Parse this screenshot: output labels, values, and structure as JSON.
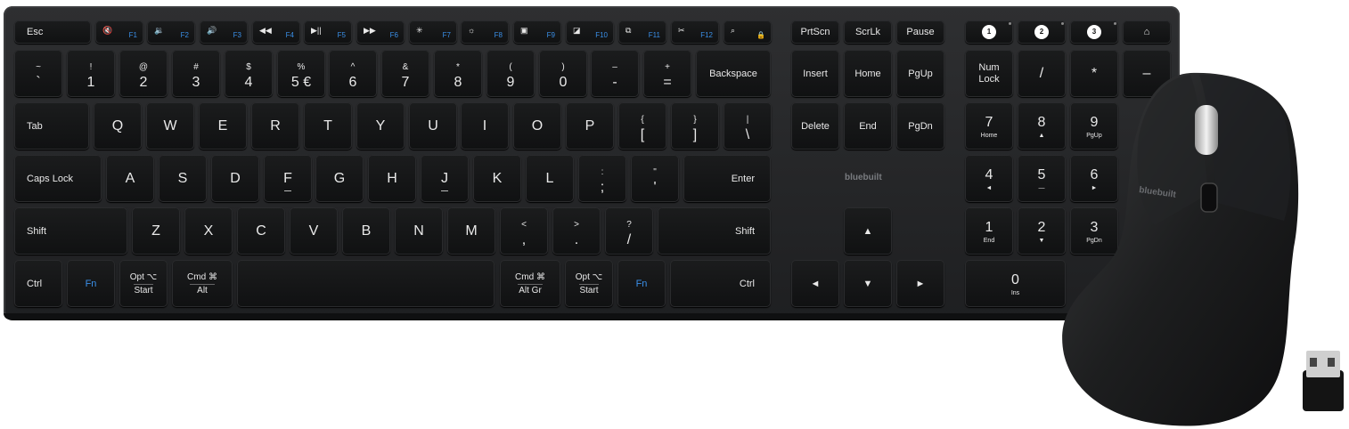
{
  "keyboard": {
    "brand": "bluebuilt",
    "row_f": [
      {
        "label": "Esc"
      },
      {
        "icon": "mute-icon",
        "glyph": "🔇",
        "fn": "F1"
      },
      {
        "icon": "volume-down-icon",
        "glyph": "🔉",
        "fn": "F2"
      },
      {
        "icon": "volume-up-icon",
        "glyph": "🔊",
        "fn": "F3"
      },
      {
        "icon": "previous-track-icon",
        "glyph": "◀◀",
        "fn": "F4"
      },
      {
        "icon": "play-pause-icon",
        "glyph": "▶||",
        "fn": "F5"
      },
      {
        "icon": "next-track-icon",
        "glyph": "▶▶",
        "fn": "F6"
      },
      {
        "icon": "brightness-down-icon",
        "glyph": "✳",
        "fn": "F7"
      },
      {
        "icon": "brightness-up-icon",
        "glyph": "☼",
        "fn": "F8"
      },
      {
        "icon": "screenshot-icon",
        "glyph": "▣",
        "fn": "F9"
      },
      {
        "icon": "window-icon",
        "glyph": "◪",
        "fn": "F10"
      },
      {
        "icon": "app-switch-icon",
        "glyph": "⧉",
        "fn": "F11"
      },
      {
        "icon": "cut-icon",
        "glyph": "✂",
        "fn": "F12"
      },
      {
        "icon": "search-icon",
        "glyph": "⌕",
        "fn": "🔒"
      }
    ],
    "row_num": [
      {
        "top": "~",
        "bot": "`"
      },
      {
        "top": "!",
        "bot": "1"
      },
      {
        "top": "@",
        "bot": "2"
      },
      {
        "top": "#",
        "bot": "3"
      },
      {
        "top": "$",
        "bot": "4"
      },
      {
        "top": "%",
        "bot": "5 €"
      },
      {
        "top": "^",
        "bot": "6"
      },
      {
        "top": "&",
        "bot": "7"
      },
      {
        "top": "*",
        "bot": "8"
      },
      {
        "top": "(",
        "bot": "9"
      },
      {
        "top": ")",
        "bot": "0"
      },
      {
        "top": "–",
        "bot": "-"
      },
      {
        "top": "+",
        "bot": "="
      }
    ],
    "backspace": "Backspace",
    "tab": "Tab",
    "row_q": [
      "Q",
      "W",
      "E",
      "R",
      "T",
      "Y",
      "U",
      "I",
      "O",
      "P"
    ],
    "brackets": [
      {
        "top": "{",
        "bot": "["
      },
      {
        "top": "}",
        "bot": "]"
      },
      {
        "top": "|",
        "bot": "\\"
      }
    ],
    "caps": "Caps Lock",
    "row_a": [
      "A",
      "S",
      "D",
      "F",
      "G",
      "H",
      "J",
      "K",
      "L"
    ],
    "row_a_punct": [
      {
        "top": ":",
        "bot": ";"
      },
      {
        "top": "\"",
        "bot": "'"
      }
    ],
    "enter": "Enter",
    "shift_left": "Shift",
    "row_z": [
      "Z",
      "X",
      "C",
      "V",
      "B",
      "N",
      "M"
    ],
    "row_z_punct": [
      {
        "top": "<",
        "bot": ","
      },
      {
        "top": ">",
        "bot": "."
      },
      {
        "top": "?",
        "bot": "/"
      }
    ],
    "shift_right": "Shift",
    "bottom": {
      "ctrl_left": "Ctrl",
      "fn_left": "Fn",
      "opt_left": {
        "top": "Opt ⌥",
        "bot": "Start"
      },
      "cmd_left": {
        "top": "Cmd ⌘",
        "bot": "Alt"
      },
      "cmd_right": {
        "top": "Cmd ⌘",
        "bot": "Alt Gr"
      },
      "opt_right": {
        "top": "Opt ⌥",
        "bot": "Start"
      },
      "fn_right": "Fn",
      "ctrl_right": "Ctrl"
    },
    "nav": {
      "prtscn": "PrtScn",
      "scrlk": "ScrLk",
      "pause": "Pause",
      "insert": "Insert",
      "home": "Home",
      "pgup": "PgUp",
      "delete": "Delete",
      "end": "End",
      "pgdn": "PgDn",
      "up": "▲",
      "left": "◄",
      "down": "▼",
      "right": "►"
    },
    "bluetooth": [
      "1",
      "2",
      "3"
    ],
    "home_icon": "⌂",
    "numpad": {
      "numlock": "Num\nLock",
      "slash": "/",
      "star": "*",
      "minus": "–",
      "n7": {
        "big": "7",
        "sub": "Home"
      },
      "n8": {
        "big": "8",
        "sub": "▲"
      },
      "n9": {
        "big": "9",
        "sub": "PgUp"
      },
      "n4": {
        "big": "4",
        "sub": "◄"
      },
      "n5": {
        "big": "5",
        "sub": "—"
      },
      "n6": {
        "big": "6",
        "sub": "►"
      },
      "n1": {
        "big": "1",
        "sub": "End"
      },
      "n2": {
        "big": "2",
        "sub": "▼"
      },
      "n3": {
        "big": "3",
        "sub": "PgDn"
      },
      "n0": {
        "big": "0",
        "sub": "Ins"
      }
    }
  },
  "mouse": {
    "brand": "bluebuilt"
  }
}
